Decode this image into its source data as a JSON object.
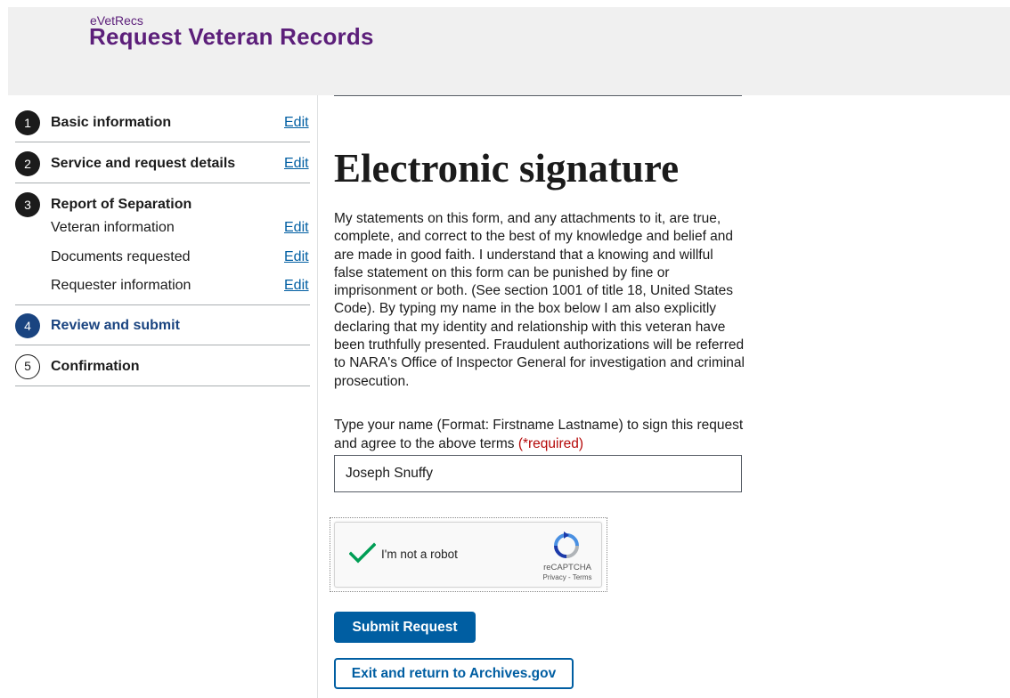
{
  "header": {
    "app_sub": "eVetRecs",
    "app_title": "Request Veteran Records"
  },
  "sidebar": {
    "steps": [
      {
        "number": "1",
        "label": "Basic information",
        "edit": "Edit",
        "state": "complete"
      },
      {
        "number": "2",
        "label": "Service and request details",
        "edit": "Edit",
        "state": "complete"
      },
      {
        "number": "3",
        "label": "Report of Separation",
        "state": "complete",
        "subitems": [
          {
            "label": "Veteran information",
            "edit": "Edit"
          },
          {
            "label": "Documents requested",
            "edit": "Edit"
          },
          {
            "label": "Requester information",
            "edit": "Edit"
          }
        ]
      },
      {
        "number": "4",
        "label": "Review and submit",
        "state": "current"
      },
      {
        "number": "5",
        "label": "Confirmation",
        "state": "upcoming"
      }
    ]
  },
  "main": {
    "title": "Electronic signature",
    "statement": "My statements on this form, and any attachments to it, are true, complete, and correct to the best of my knowledge and belief and are made in good faith. I understand that a knowing and willful false statement on this form can be punished by fine or imprisonment or both. (See section 1001 of title 18, United States Code). By typing my name in the box below I am also explicitly declaring that my identity and relationship with this veteran have been truthfully presented. Fraudulent authorizations will be referred to NARA's Office of Inspector General for investigation and criminal prosecution.",
    "name_label": "Type your name (Format: Firstname Lastname) to sign this request and agree to the above terms",
    "required_text": "(*required)",
    "name_value": "Joseph Snuffy",
    "captcha": {
      "label": "I'm not a robot",
      "brand": "reCAPTCHA",
      "terms": "Privacy - Terms",
      "checked": true
    },
    "submit_label": "Submit Request",
    "exit_label": "Exit and return to Archives.gov"
  },
  "colors": {
    "brand_purple": "#5c1f7a",
    "primary_blue": "#005ea2",
    "current_step_blue": "#1a4480",
    "required_red": "#b50909",
    "check_green": "#009e55"
  }
}
